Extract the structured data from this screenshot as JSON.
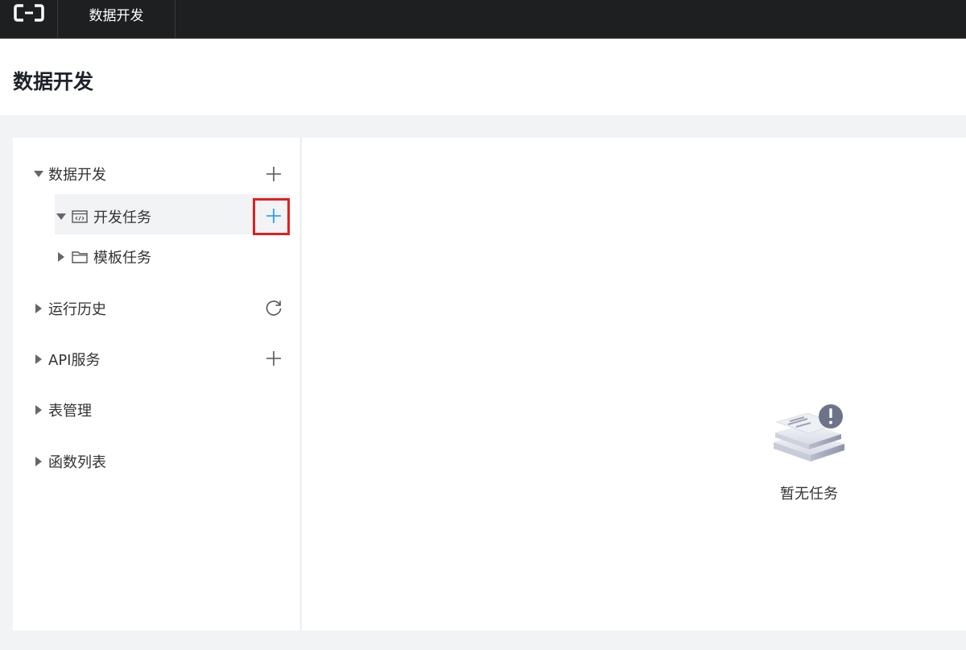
{
  "topbar": {
    "logo_icon": "alibaba-cloud-logo-icon",
    "title": "数据开发"
  },
  "page": {
    "title": "数据开发"
  },
  "sidebar": {
    "groups": [
      {
        "label": "数据开发",
        "expanded": true,
        "action_icon": "plus-icon"
      },
      {
        "label": "运行历史",
        "expanded": false,
        "action_icon": "refresh-icon"
      },
      {
        "label": "API服务",
        "expanded": false,
        "action_icon": "plus-icon"
      },
      {
        "label": "表管理",
        "expanded": false
      },
      {
        "label": "函数列表",
        "expanded": false
      }
    ],
    "children": [
      {
        "label": "开发任务",
        "expanded": true,
        "icon": "code-window-icon",
        "action_icon": "plus-icon",
        "selected": true
      },
      {
        "label": "模板任务",
        "expanded": false,
        "icon": "folder-icon"
      }
    ]
  },
  "main": {
    "empty_text": "暂无任务",
    "empty_icon": "empty-task-icon"
  },
  "colors": {
    "topbar": "#1e1f21",
    "accent": "#1890ff",
    "highlight_border": "#e02020",
    "selected_row": "#f2f3f5"
  }
}
